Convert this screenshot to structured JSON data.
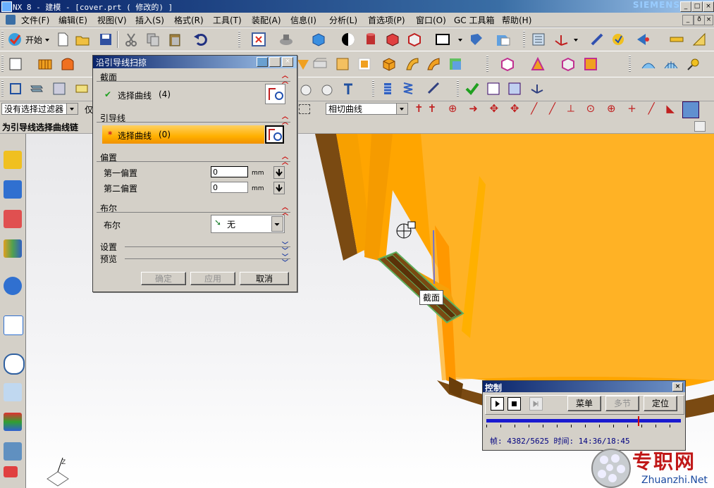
{
  "app": {
    "title": "NX 8 - 建模 - [cover.prt ( 修改的) ]",
    "brand": "SIEMENS"
  },
  "menu": [
    "文件(F)",
    "编辑(E)",
    "视图(V)",
    "插入(S)",
    "格式(R)",
    "工具(T)",
    "装配(A)",
    "信息(I)",
    "分析(L)",
    "首选项(P)",
    "窗口(O)",
    "GC 工具箱",
    "帮助(H)"
  ],
  "toolbar": {
    "start_label": "开始"
  },
  "filterbar": {
    "selection_filter": "没有选择过滤器",
    "second_label": "仅",
    "curve_rule": "相切曲线"
  },
  "cue_line": "为引导线选择曲线链",
  "dialog": {
    "title": "沿引导线扫掠",
    "section": {
      "header": "截面",
      "select_label": "选择曲线",
      "count": "(4)"
    },
    "guide": {
      "header": "引导线",
      "select_label": "选择曲线",
      "count": "(0)"
    },
    "offset": {
      "header": "偏置",
      "first_label": "第一偏置",
      "first_value": "0",
      "second_label": "第二偏置",
      "second_value": "0",
      "unit": "mm"
    },
    "boolean": {
      "header": "布尔",
      "label": "布尔",
      "value": "无"
    },
    "settings_label": "设置",
    "preview_label": "预览",
    "ok_label": "确定",
    "apply_label": "应用",
    "cancel_label": "取消"
  },
  "viewport": {
    "tag_label": "截面"
  },
  "control": {
    "title": "控制",
    "menu_label": "菜单",
    "multi_label": "多节",
    "locate_label": "定位",
    "frame_text": "帧: 4382/5625 时间: 14:36/18:45",
    "progress": 0.78
  },
  "watermark": {
    "cn": "专职网",
    "en": "Zhuanzhi.Net"
  },
  "colors": {
    "part_orange": "#ffa500",
    "part_brown": "#7a4a12",
    "titlebar": "#0a246a",
    "guide_highlight": "#ffb000"
  }
}
